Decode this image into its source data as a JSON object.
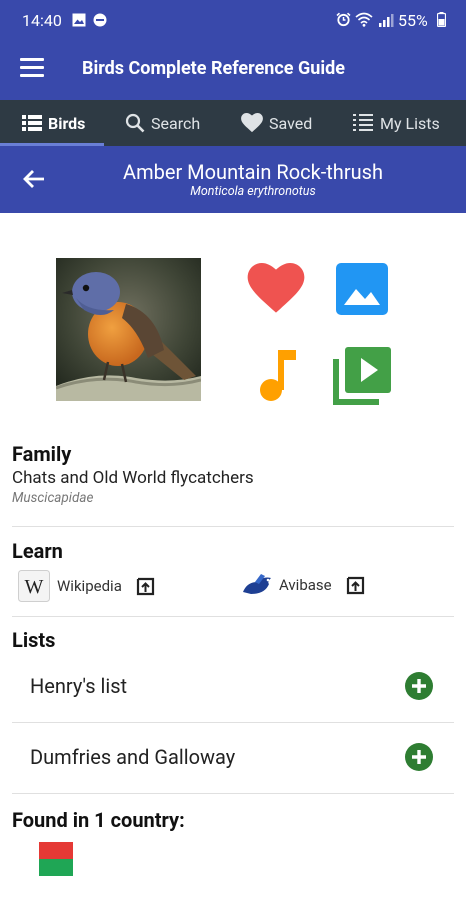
{
  "status_bar": {
    "time": "14:40",
    "battery": "55%"
  },
  "app_bar": {
    "title": "Birds Complete Reference Guide"
  },
  "tabs": [
    {
      "label": "Birds",
      "icon": "list-icon"
    },
    {
      "label": "Search",
      "icon": "search-icon"
    },
    {
      "label": "Saved",
      "icon": "heart-icon"
    },
    {
      "label": "My Lists",
      "icon": "lists-icon"
    }
  ],
  "bird": {
    "common_name": "Amber Mountain Rock-thrush",
    "scientific_name": "Monticola erythronotus"
  },
  "family": {
    "title": "Family",
    "name": "Chats and Old World flycatchers",
    "scientific": "Muscicapidae"
  },
  "learn": {
    "title": "Learn",
    "links": [
      {
        "label": "Wikipedia"
      },
      {
        "label": "Avibase"
      }
    ]
  },
  "lists": {
    "title": "Lists",
    "items": [
      {
        "label": "Henry's list"
      },
      {
        "label": "Dumfries and Galloway"
      }
    ]
  },
  "found_in": {
    "title": "Found in 1 country:"
  },
  "colors": {
    "primary": "#3949ab",
    "tab_bar": "#2e3a44",
    "heart": "#ef5350",
    "image": "#2196f3",
    "music": "#ffa000",
    "video": "#43a047",
    "add": "#2e7d32"
  }
}
